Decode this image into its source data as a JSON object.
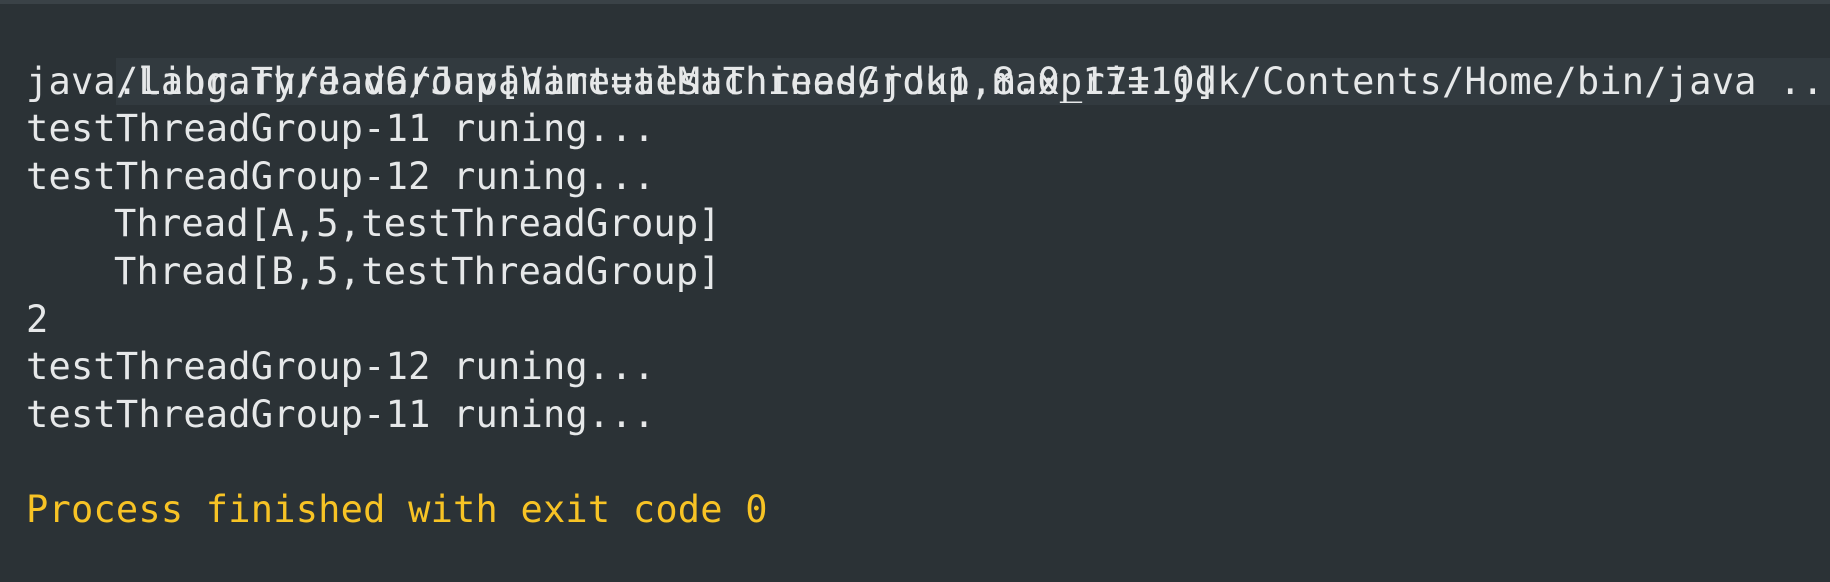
{
  "console": {
    "command": "/Library/Java/JavaVirtualMachines/jdk1.8.0_171.jdk/Contents/Home/bin/java ...",
    "lines": [
      "java.lang.ThreadGroup[name=testThreadGroup,maxpri=10]",
      "testThreadGroup-11 runing...",
      "testThreadGroup-12 runing...",
      "Thread[A,5,testThreadGroup]",
      "Thread[B,5,testThreadGroup]",
      "2",
      "testThreadGroup-12 runing...",
      "testThreadGroup-11 runing..."
    ],
    "exit_message": "Process finished with exit code 0"
  },
  "colors": {
    "background": "#2b3236",
    "text": "#e6e8e9",
    "exit_message": "#f7c325",
    "command_highlight": "#323a3f"
  }
}
